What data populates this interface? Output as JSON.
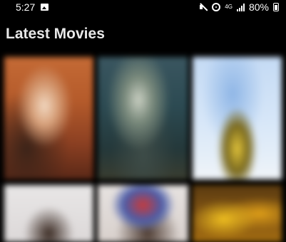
{
  "status_bar": {
    "time": "5:27",
    "network_label": "4G",
    "battery_percent": "80%",
    "icons": [
      "gallery-icon",
      "mute-icon",
      "hotspot-icon",
      "signal-icon",
      "battery-icon"
    ]
  },
  "section": {
    "title": "Latest Movies"
  },
  "posters": [
    {
      "dominant_color": "#b55b2b"
    },
    {
      "dominant_color": "#2c4a52"
    },
    {
      "dominant_color": "#d6e6f8"
    },
    {
      "dominant_color": "#dcd8d8"
    },
    {
      "dominant_color": "#d8d0cc"
    },
    {
      "dominant_color": "#8a5a14"
    }
  ]
}
